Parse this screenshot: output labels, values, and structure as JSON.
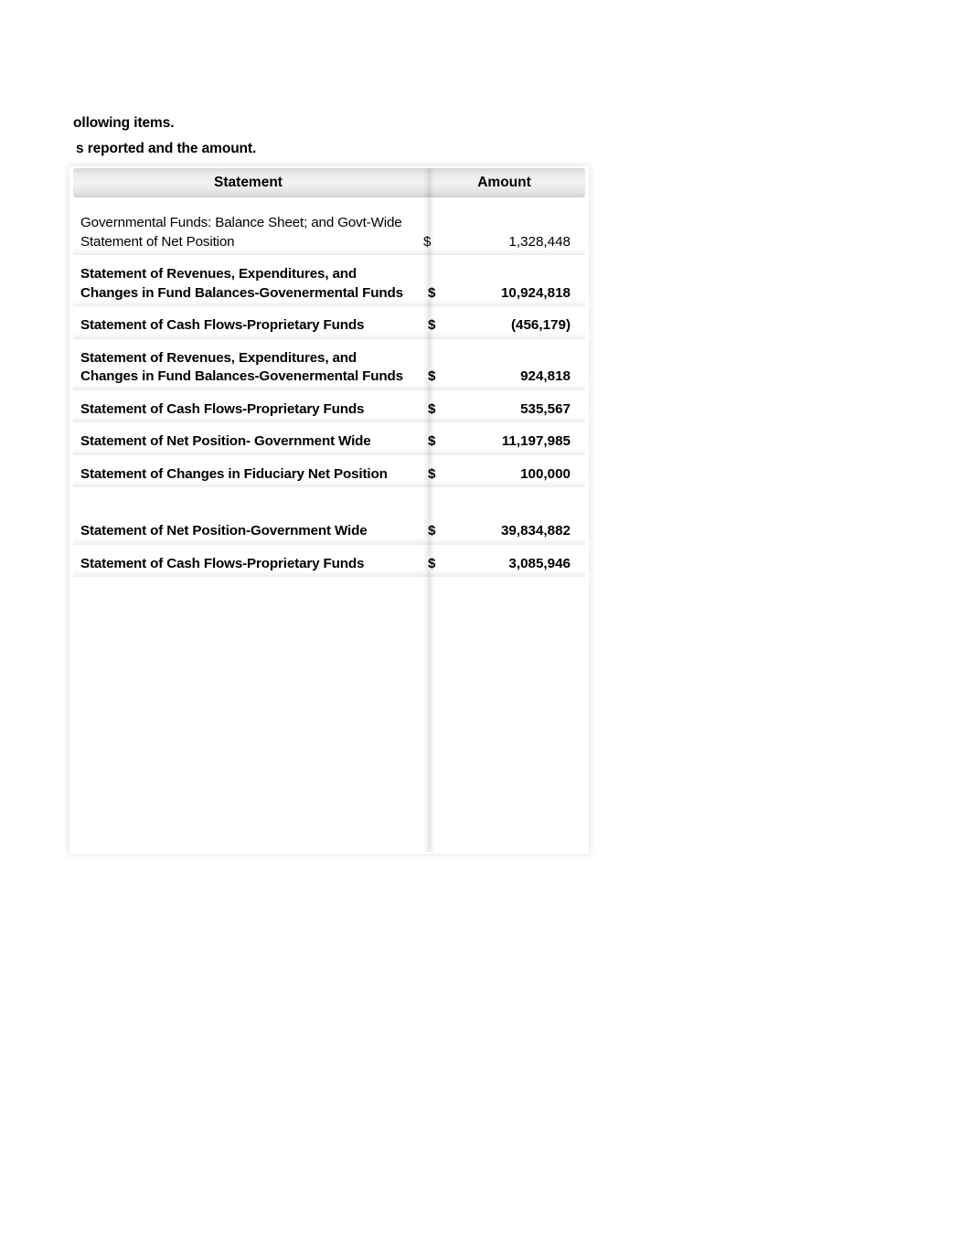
{
  "intro": {
    "line1": "ollowing items.",
    "line2": "s reported and the amount."
  },
  "table": {
    "headers": {
      "statement": "Statement",
      "amount": "Amount"
    },
    "currency_symbol": "$",
    "rows": [
      {
        "statement": "Governmental Funds:  Balance Sheet; and Govt-Wide Statement of Net Position",
        "symbol": "$",
        "amount": "1,328,448",
        "bold": false
      },
      {
        "statement": "Statement of Revenues, Expenditures, and Changes in Fund Balances-Govenermental Funds",
        "symbol": "$",
        "amount": "10,924,818",
        "bold": true
      },
      {
        "statement": "Statement of Cash Flows-Proprietary Funds",
        "symbol": "$",
        "amount": "(456,179)",
        "bold": true
      },
      {
        "statement": "Statement of Revenues, Expenditures, and Changes in Fund Balances-Govenermental Funds",
        "symbol": "$",
        "amount": "924,818",
        "bold": true
      },
      {
        "statement": "Statement of Cash Flows-Proprietary Funds",
        "symbol": "$",
        "amount": "535,567",
        "bold": true
      },
      {
        "statement": "Statement of Net Position- Government Wide",
        "symbol": "$",
        "amount": "11,197,985",
        "bold": true
      },
      {
        "statement": "Statement of Changes in Fiduciary Net Position",
        "symbol": "$",
        "amount": "100,000",
        "bold": true
      },
      {
        "statement": "Statement of Net Position-Government Wide",
        "symbol": "$",
        "amount": "39,834,882",
        "bold": true
      },
      {
        "statement": "Statement of Cash Flows-Proprietary Funds",
        "symbol": "$",
        "amount": "3,085,946",
        "bold": true
      }
    ]
  }
}
